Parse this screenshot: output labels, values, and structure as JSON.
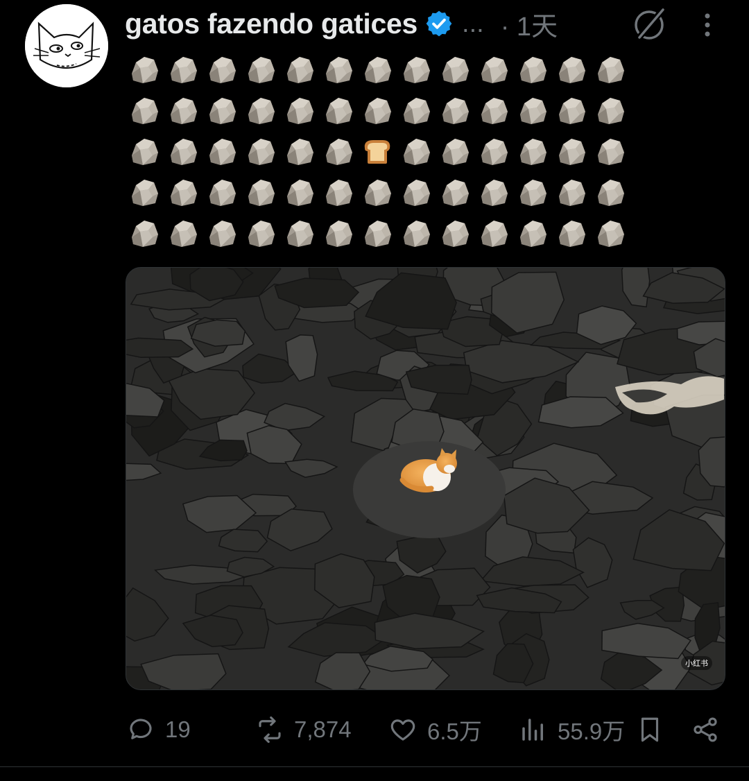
{
  "tweet": {
    "author_name": "gatos fazendo gatices",
    "handle_ellipsis": "...",
    "time": "· 1天",
    "text_emoji": {
      "rows": 5,
      "cols": 13,
      "rock_icon": "rock-emoji",
      "bread_icon": "bread-emoji",
      "bread_position": {
        "row": 3,
        "col": 7
      }
    },
    "media": {
      "watermark": "小红书"
    },
    "actions": {
      "replies": "19",
      "reposts": "7,874",
      "likes": "6.5万",
      "views": "55.9万"
    },
    "colors": {
      "background": "#000000",
      "text": "#e7e9ea",
      "muted": "#71767b",
      "verified": "#1d9bf0"
    }
  }
}
